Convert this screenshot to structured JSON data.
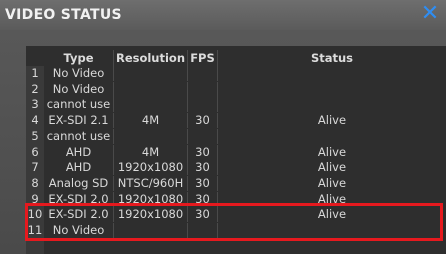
{
  "window": {
    "title": "VIDEO STATUS",
    "close_glyph": "✕"
  },
  "table": {
    "headers": {
      "num": "",
      "type": "Type",
      "resolution": "Resolution",
      "fps": "FPS",
      "status": "Status"
    },
    "rows": [
      {
        "num": "1",
        "type": "No Video",
        "resolution": "",
        "fps": "",
        "status": ""
      },
      {
        "num": "2",
        "type": "No Video",
        "resolution": "",
        "fps": "",
        "status": ""
      },
      {
        "num": "3",
        "type": "cannot use",
        "resolution": "",
        "fps": "",
        "status": ""
      },
      {
        "num": "4",
        "type": "EX-SDI 2.1",
        "resolution": "4M",
        "fps": "30",
        "status": "Alive"
      },
      {
        "num": "5",
        "type": "cannot use",
        "resolution": "",
        "fps": "",
        "status": ""
      },
      {
        "num": "6",
        "type": "AHD",
        "resolution": "4M",
        "fps": "30",
        "status": "Alive"
      },
      {
        "num": "7",
        "type": "AHD",
        "resolution": "1920x1080",
        "fps": "30",
        "status": "Alive"
      },
      {
        "num": "8",
        "type": "Analog SD",
        "resolution": "NTSC/960H",
        "fps": "30",
        "status": "Alive"
      },
      {
        "num": "9",
        "type": "EX-SDI 2.0",
        "resolution": "1920x1080",
        "fps": "30",
        "status": "Alive"
      },
      {
        "num": "10",
        "type": "EX-SDI 2.0",
        "resolution": "1920x1080",
        "fps": "30",
        "status": "Alive"
      },
      {
        "num": "11",
        "type": "No Video",
        "resolution": "",
        "fps": "",
        "status": ""
      }
    ]
  },
  "colors": {
    "highlight": "#e6191e",
    "close_icon": "#2f8df2"
  }
}
